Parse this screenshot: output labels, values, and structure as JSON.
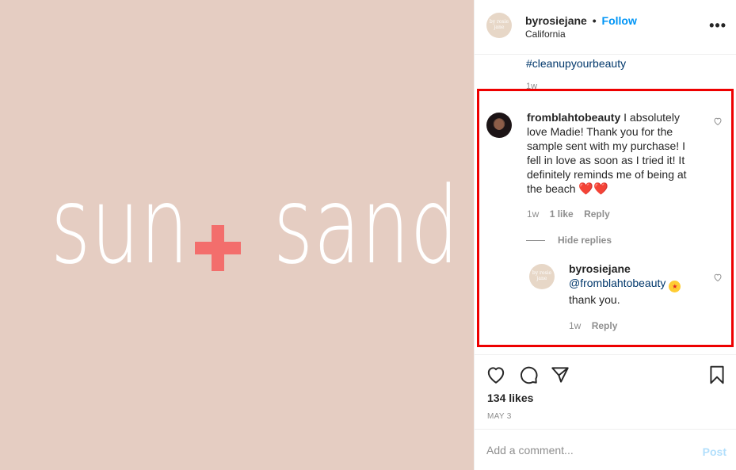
{
  "media": {
    "word_left": "sun",
    "word_right": "sand",
    "background_color": "#e5cdc2",
    "plus_color": "#f36e6c"
  },
  "header": {
    "avatar_text": "by rosie jane",
    "username": "byrosiejane",
    "separator": "•",
    "follow_label": "Follow",
    "location": "California",
    "more_icon": "more-horizontal-icon"
  },
  "caption": {
    "hashtag": "#cleanupyourbeauty",
    "time": "1w"
  },
  "comment": {
    "username": "fromblahtobeauty",
    "text": "I absolutely love Madie! Thank you for the sample sent with my purchase! I fell in love as soon as I tried it! It definitely reminds me of being at the beach",
    "emoji": "❤️❤️",
    "time": "1w",
    "likes": "1 like",
    "reply_label": "Reply"
  },
  "hide_replies_label": "Hide replies",
  "reply": {
    "avatar_text": "by rosie jane",
    "username": "byrosiejane",
    "mention": "@fromblahtobeauty",
    "text": "thank you.",
    "time": "1w",
    "reply_label": "Reply"
  },
  "actions": {
    "likes": "134 likes",
    "date": "MAY 3"
  },
  "add_comment": {
    "placeholder": "Add a comment...",
    "post_label": "Post"
  },
  "colors": {
    "accent": "#0095f6",
    "highlight": "#ee0000"
  }
}
